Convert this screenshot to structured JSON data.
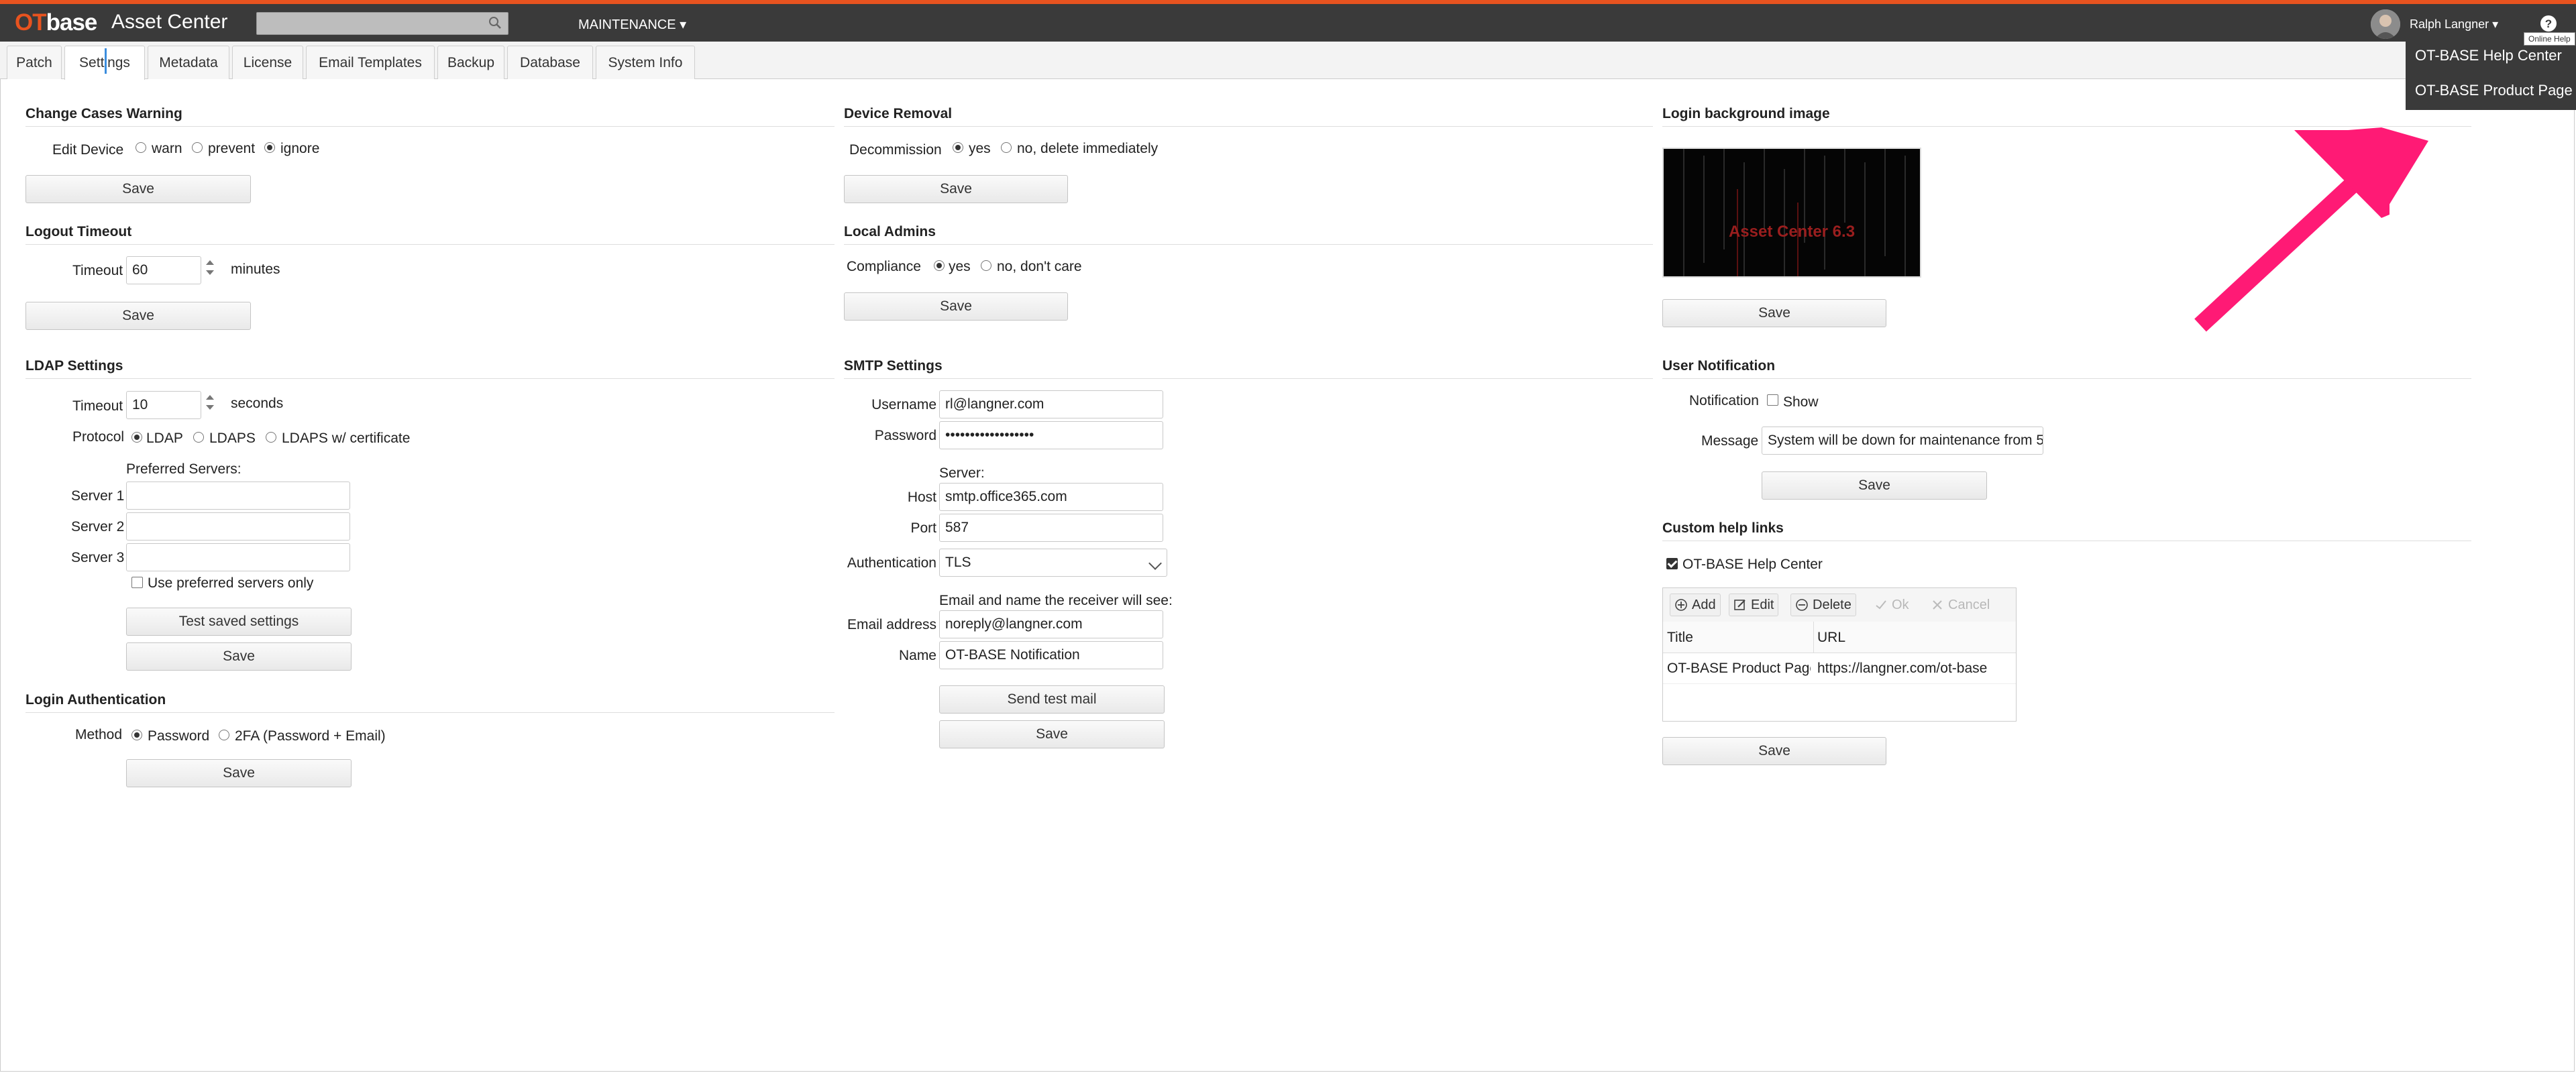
{
  "app": {
    "logo_ot": "OT",
    "logo_base": "base",
    "title": "Asset Center"
  },
  "header": {
    "menu_label": "MAINTENANCE ▾",
    "user_name": "Ralph Langner ▾",
    "help_tooltip": "Online Help"
  },
  "help_menu": {
    "items": [
      "OT-BASE Help Center",
      "OT-BASE Product Page"
    ]
  },
  "tabs": [
    "Patch",
    "Settings",
    "Metadata",
    "License",
    "Email Templates",
    "Backup",
    "Database",
    "System Info"
  ],
  "change_cases": {
    "title": "Change Cases Warning",
    "label": "Edit Device",
    "options": [
      "warn",
      "prevent",
      "ignore"
    ],
    "selected": "ignore",
    "save": "Save"
  },
  "logout": {
    "title": "Logout Timeout",
    "label": "Timeout",
    "value": "60",
    "unit": "minutes",
    "save": "Save"
  },
  "ldap": {
    "title": "LDAP Settings",
    "timeout_label": "Timeout",
    "timeout_value": "10",
    "timeout_unit": "seconds",
    "protocol_label": "Protocol",
    "protocols": [
      "LDAP",
      "LDAPS",
      "LDAPS w/ certificate"
    ],
    "selected": "LDAP",
    "preferred_label": "Preferred Servers:",
    "servers": [
      "Server 1",
      "Server 2",
      "Server 3"
    ],
    "only_preferred": "Use preferred servers only",
    "test": "Test saved settings",
    "save": "Save"
  },
  "login_auth": {
    "title": "Login Authentication",
    "label": "Method",
    "options": [
      "Password",
      "2FA (Password + Email)"
    ],
    "selected": "Password",
    "save": "Save"
  },
  "device_removal": {
    "title": "Device Removal",
    "label": "Decommission",
    "options": [
      "yes",
      "no, delete immediately"
    ],
    "selected": "yes",
    "save": "Save"
  },
  "local_admins": {
    "title": "Local Admins",
    "label": "Compliance",
    "options": [
      "yes",
      "no, don't care"
    ],
    "selected": "yes",
    "save": "Save"
  },
  "smtp": {
    "title": "SMTP Settings",
    "username_label": "Username",
    "username": "rl@langner.com",
    "password_label": "Password",
    "password": "••••••••••••••••••",
    "server_label": "Server:",
    "host_label": "Host",
    "host": "smtp.office365.com",
    "port_label": "Port",
    "port": "587",
    "auth_label": "Authentication",
    "auth": "TLS",
    "email_hint": "Email and name the receiver will see:",
    "email_label": "Email address",
    "email": "noreply@langner.com",
    "name_label": "Name",
    "name": "OT-BASE Notification",
    "test": "Send test mail",
    "save": "Save"
  },
  "login_bg": {
    "title": "Login background image",
    "image_text": "Asset Center 6.3",
    "save": "Save"
  },
  "user_notification": {
    "title": "User Notification",
    "notif_label": "Notification",
    "show": "Show",
    "message_label": "Message",
    "message": "System will be down for maintenance from 5",
    "save": "Save"
  },
  "custom_help": {
    "title": "Custom help links",
    "checkbox": "OT-BASE Help Center",
    "toolbar": [
      "Add",
      "Edit",
      "Delete",
      "Ok",
      "Cancel"
    ],
    "columns": [
      "Title",
      "URL"
    ],
    "rows": [
      {
        "title": "OT-BASE Product Page",
        "url": "https://langner.com/ot-base"
      }
    ],
    "save": "Save"
  },
  "colors": {
    "brand": "#e8531f",
    "topbar": "#3a3a3a",
    "annotation_arrow": "#ff1a75"
  }
}
